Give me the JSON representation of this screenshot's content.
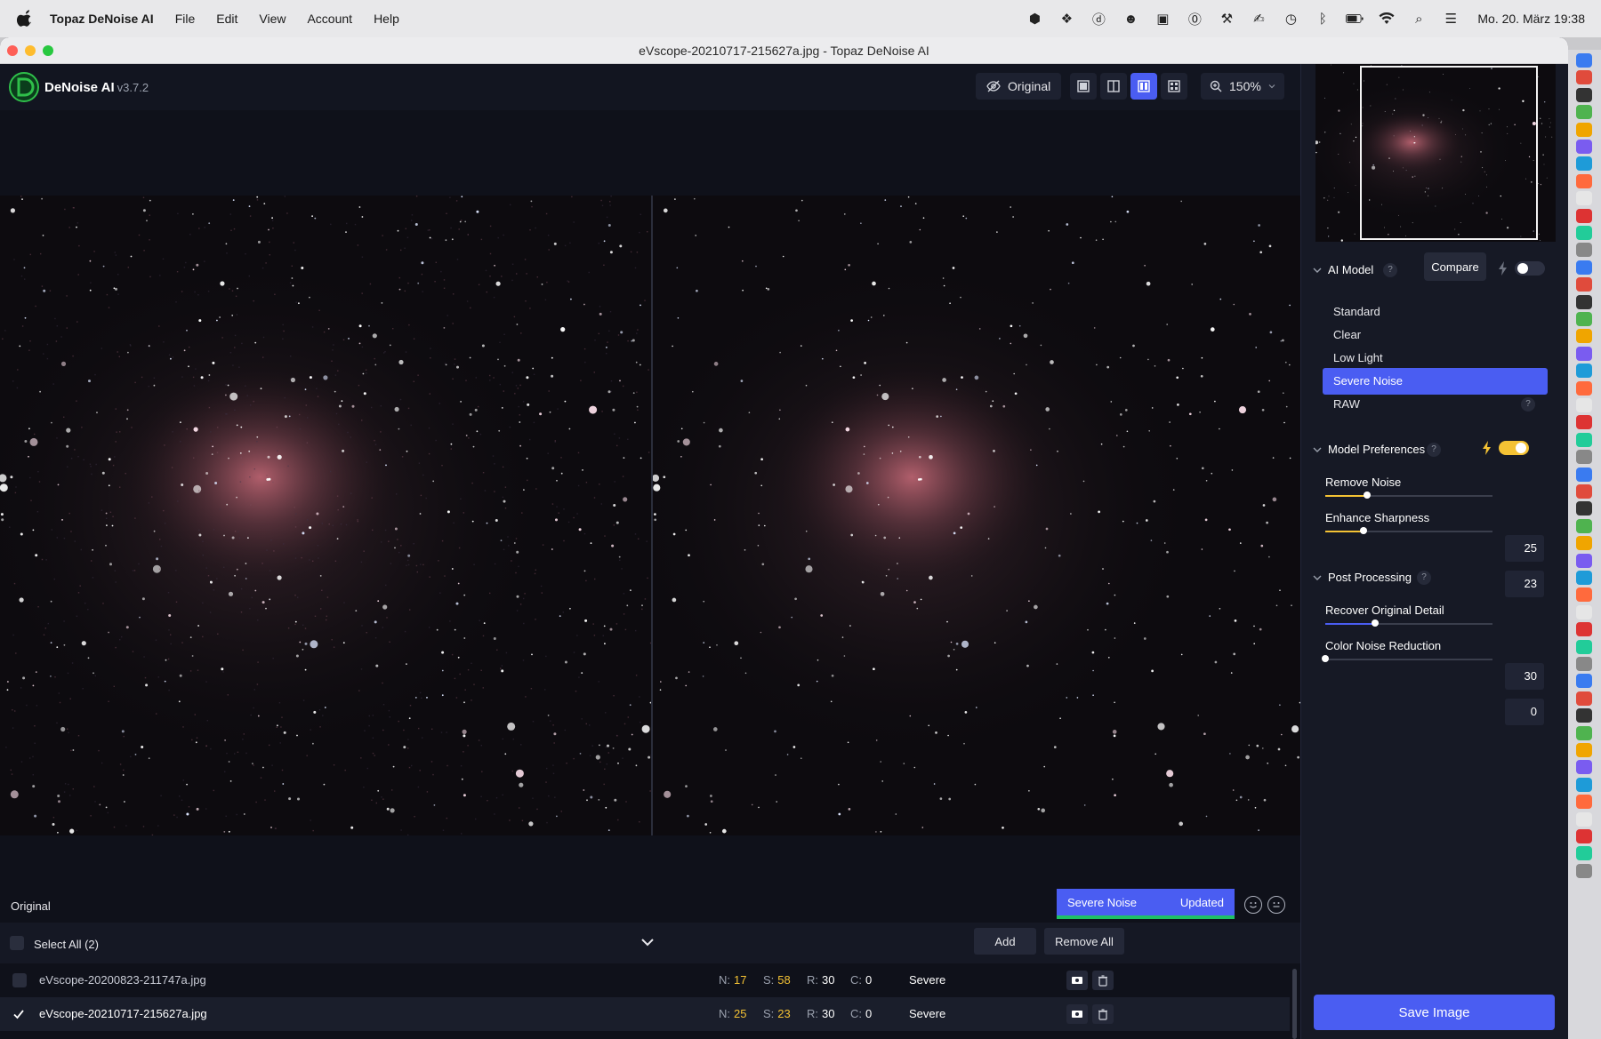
{
  "menubar": {
    "app_name": "Topaz DeNoise AI",
    "menus": [
      "File",
      "Edit",
      "View",
      "Account",
      "Help"
    ],
    "clock": "Mo. 20. März  19:38"
  },
  "window": {
    "title": "eVscope-20210717-215627a.jpg - Topaz DeNoise AI"
  },
  "appbar": {
    "brand": "DeNoise AI",
    "version": "v3.7.2",
    "original_label": "Original",
    "zoom_label": "150%"
  },
  "preview": {
    "original_label": "Original",
    "model_name": "Severe Noise",
    "status": "Updated"
  },
  "filelist": {
    "select_all": "Select All (2)",
    "add": "Add",
    "remove_all": "Remove All",
    "labels": {
      "n": "N:",
      "s": "S:",
      "r": "R:",
      "c": "C:"
    },
    "files": [
      {
        "name": "eVscope-20200823-211747a.jpg",
        "n": "17",
        "s": "58",
        "r": "30",
        "c": "0",
        "mode": "Severe",
        "checked": false
      },
      {
        "name": "eVscope-20210717-215627a.jpg",
        "n": "25",
        "s": "23",
        "r": "30",
        "c": "0",
        "mode": "Severe",
        "checked": true
      }
    ]
  },
  "panel": {
    "ai_model": {
      "title": "AI Model",
      "help": "?",
      "compare": "Compare",
      "models": [
        "Standard",
        "Clear",
        "Low Light",
        "Severe Noise",
        "RAW"
      ],
      "selected": "Severe Noise",
      "raw_help": "?"
    },
    "model_preferences": {
      "title": "Model Preferences",
      "help": "?",
      "remove_noise_label": "Remove Noise",
      "remove_noise_value": "25",
      "remove_noise_level": 0.25,
      "enhance_sharpness_label": "Enhance Sharpness",
      "enhance_sharpness_value": "23",
      "enhance_sharpness_level": 0.23
    },
    "post_processing": {
      "title": "Post Processing",
      "help": "?",
      "recover_label": "Recover Original Detail",
      "recover_value": "30",
      "recover_level": 0.3,
      "color_label": "Color Noise Reduction",
      "color_value": "0",
      "color_level": 0.0
    },
    "save": "Save Image"
  },
  "colors": {
    "accent": "#4a5df2",
    "highlight": "#f4c234",
    "status_green": "#1fc065"
  }
}
